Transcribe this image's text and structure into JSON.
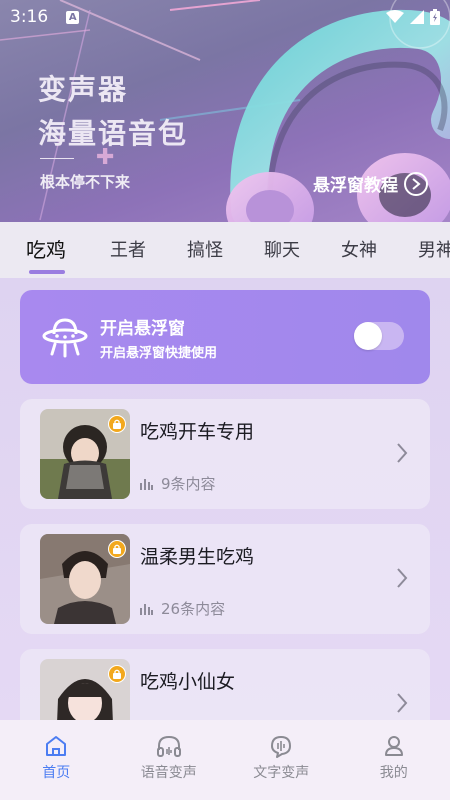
{
  "status_bar": {
    "time": "3:16",
    "notification_letter": "A"
  },
  "banner": {
    "title_line1": "变声器",
    "title_line2": "海量语音包",
    "subtitle": "根本停不下来",
    "tutorial_link": "悬浮窗教程"
  },
  "tabs": [
    {
      "label": "吃鸡",
      "active": true
    },
    {
      "label": "王者"
    },
    {
      "label": "搞怪"
    },
    {
      "label": "聊天"
    },
    {
      "label": "女神"
    },
    {
      "label": "男神"
    }
  ],
  "float_window": {
    "title": "开启悬浮窗",
    "subtitle": "开启悬浮窗快捷使用",
    "enabled": false
  },
  "packs": [
    {
      "title": "吃鸡开车专用",
      "count": "9条内容",
      "locked": true
    },
    {
      "title": "温柔男生吃鸡",
      "count": "26条内容",
      "locked": true
    },
    {
      "title": "吃鸡小仙女",
      "count": "",
      "locked": true
    }
  ],
  "bottom_nav": [
    {
      "label": "首页",
      "icon": "home-icon",
      "active": true
    },
    {
      "label": "语音变声",
      "icon": "headphones-icon"
    },
    {
      "label": "文字变声",
      "icon": "text-voice-icon"
    },
    {
      "label": "我的",
      "icon": "profile-icon"
    }
  ],
  "colors": {
    "accent": "#a889ef",
    "nav_active": "#4c7df2",
    "lock_badge": "#f2a81d"
  }
}
